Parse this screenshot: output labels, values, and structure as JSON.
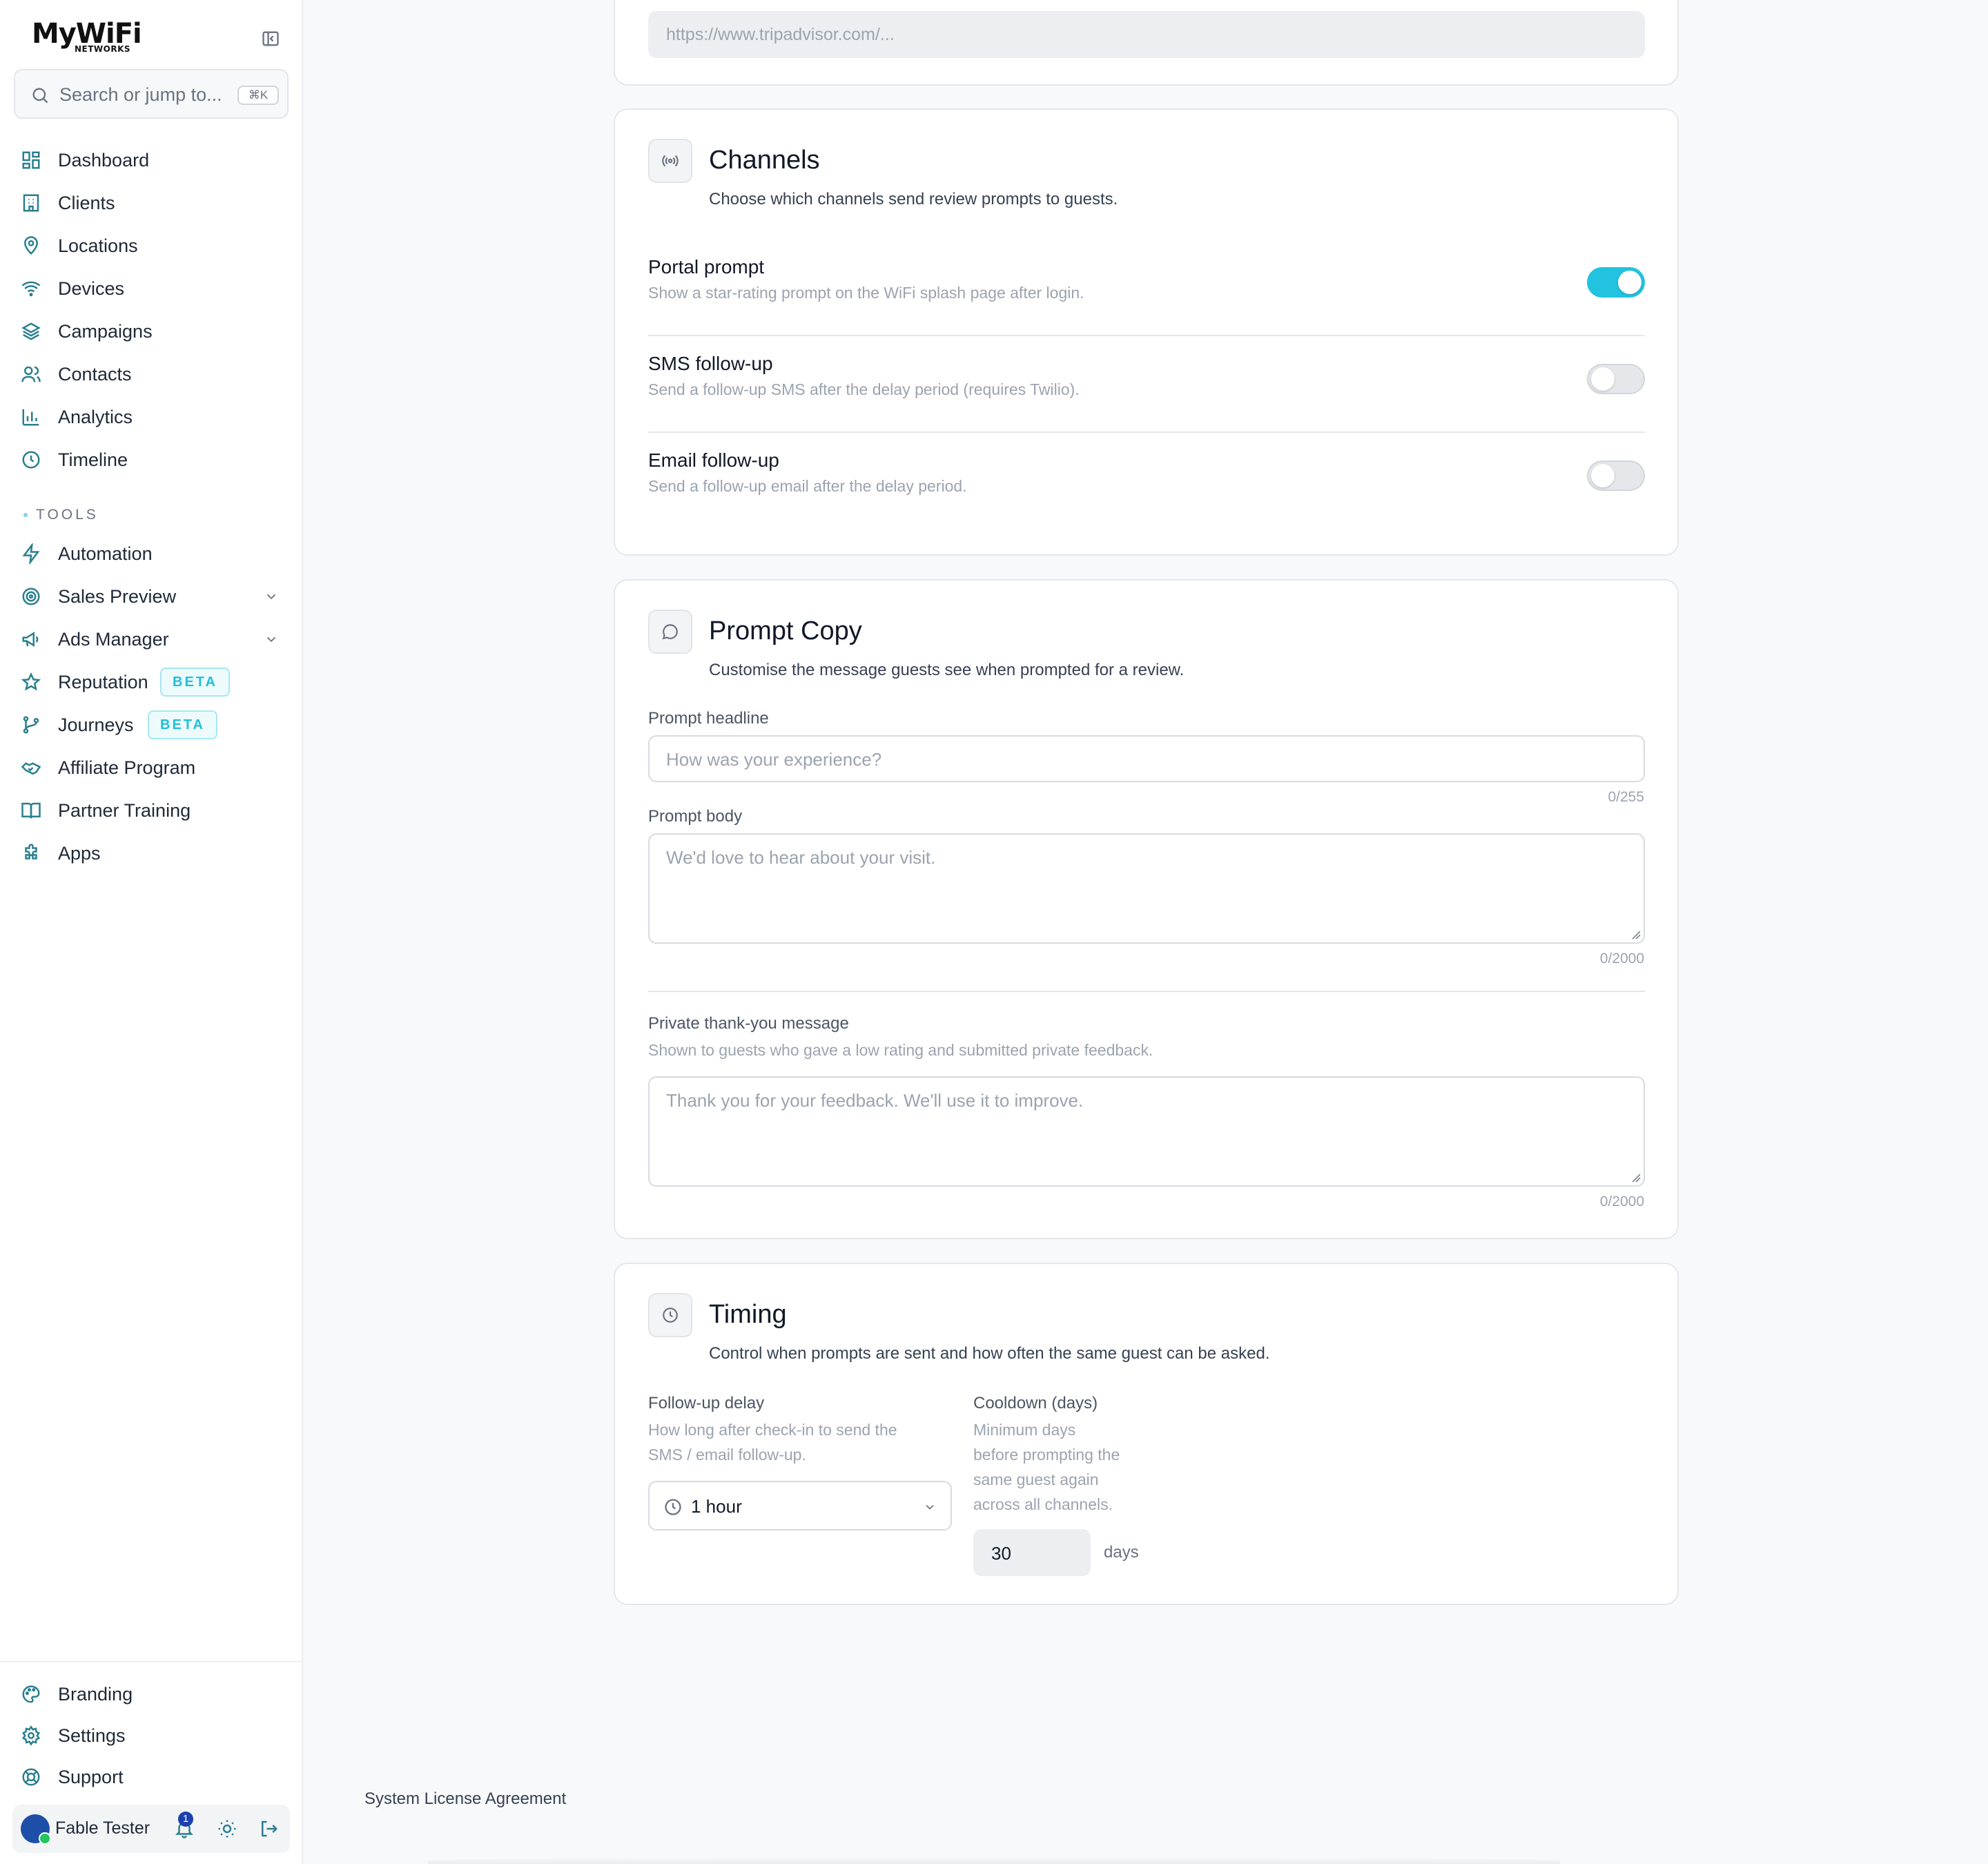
{
  "brand": {
    "word": "MyWiFi",
    "sub": "NETWORKS"
  },
  "search": {
    "placeholder": "Search or jump to...",
    "shortcut": "⌘K"
  },
  "nav": {
    "main": [
      {
        "label": "Dashboard",
        "icon": "grid-icon"
      },
      {
        "label": "Clients",
        "icon": "building-icon"
      },
      {
        "label": "Locations",
        "icon": "map-pin-icon"
      },
      {
        "label": "Devices",
        "icon": "wifi-icon"
      },
      {
        "label": "Campaigns",
        "icon": "layers-icon"
      },
      {
        "label": "Contacts",
        "icon": "users-icon"
      },
      {
        "label": "Analytics",
        "icon": "bar-chart-icon"
      },
      {
        "label": "Timeline",
        "icon": "clock-icon"
      }
    ],
    "tools_label": "TOOLS",
    "tools": [
      {
        "label": "Automation",
        "icon": "zap-icon"
      },
      {
        "label": "Sales Preview",
        "icon": "target-icon"
      },
      {
        "label": "Ads Manager",
        "icon": "megaphone-icon"
      },
      {
        "label": "Reputation",
        "icon": "star-icon",
        "badge": "BETA"
      },
      {
        "label": "Journeys",
        "icon": "branch-icon",
        "badge": "BETA"
      },
      {
        "label": "Affiliate Program",
        "icon": "handshake-icon"
      },
      {
        "label": "Partner Training",
        "icon": "book-icon"
      },
      {
        "label": "Apps",
        "icon": "puzzle-icon"
      }
    ],
    "bottom": [
      {
        "label": "Branding",
        "icon": "palette-icon"
      },
      {
        "label": "Settings",
        "icon": "gear-icon"
      },
      {
        "label": "Support",
        "icon": "lifebuoy-icon"
      }
    ]
  },
  "user": {
    "name": "Fable Tester",
    "notifications": "1"
  },
  "url_field": {
    "placeholder": "https://www.tripadvisor.com/..."
  },
  "channels": {
    "title": "Channels",
    "subtitle": "Choose which channels send review prompts to guests.",
    "items": [
      {
        "label": "Portal prompt",
        "desc": "Show a star-rating prompt on the WiFi splash page after login.",
        "enabled": true
      },
      {
        "label": "SMS follow-up",
        "desc": "Send a follow-up SMS after the delay period (requires Twilio).",
        "enabled": false
      },
      {
        "label": "Email follow-up",
        "desc": "Send a follow-up email after the delay period.",
        "enabled": false
      }
    ]
  },
  "prompt_copy": {
    "title": "Prompt Copy",
    "subtitle": "Customise the message guests see when prompted for a review.",
    "headline_label": "Prompt headline",
    "headline_placeholder": "How was your experience?",
    "headline_counter": "0/255",
    "body_label": "Prompt body",
    "body_placeholder": "We'd love to hear about your visit.",
    "body_counter": "0/2000",
    "thanks_label": "Private thank-you message",
    "thanks_hint": "Shown to guests who gave a low rating and submitted private feedback.",
    "thanks_placeholder": "Thank you for your feedback. We'll use it to improve.",
    "thanks_counter": "0/2000"
  },
  "timing": {
    "title": "Timing",
    "subtitle": "Control when prompts are sent and how often the same guest can be asked.",
    "delay_label": "Follow-up delay",
    "delay_hint_1": "How long after check-in to send the",
    "delay_hint_2": "SMS / email follow-up.",
    "delay_value": "1 hour",
    "cooldown_label": "Cooldown (days)",
    "cooldown_hint_1": "Minimum days",
    "cooldown_hint_2": "before prompting the",
    "cooldown_hint_3": "same guest again",
    "cooldown_hint_4": "across all channels.",
    "cooldown_value": "30",
    "cooldown_unit": "days"
  },
  "footer": {
    "license": "System License Agreement"
  },
  "colors": {
    "accent": "#22c3e0",
    "icon": "#2a7f8f",
    "badge_text": "#22bfd8"
  }
}
